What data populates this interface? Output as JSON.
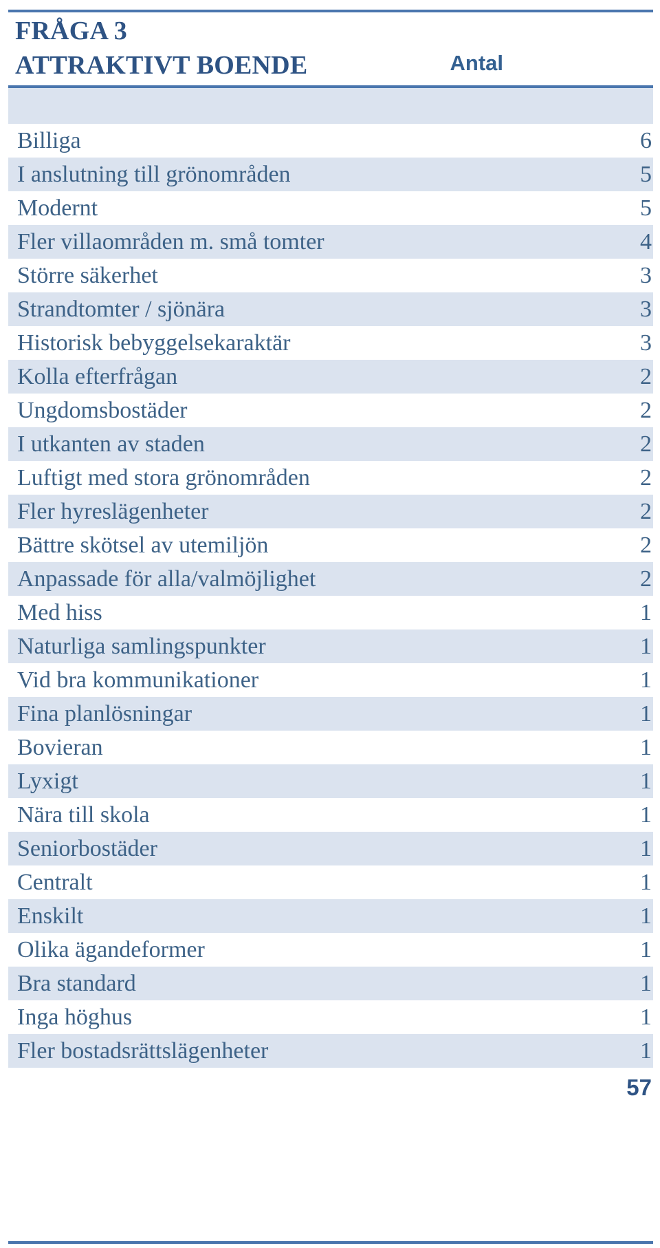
{
  "header": {
    "title_line1": "FRÅGA 3",
    "title_line2": "ATTRAKTIVT BOENDE",
    "count_column_label": "Antal"
  },
  "colors": {
    "rule": "#4a76ae",
    "heading_text": "#2e5384",
    "body_text": "#3d6287",
    "row_shaded": "#dbe3ef",
    "row_plain": "#ffffff"
  },
  "table": {
    "rows": [
      {
        "label": "Billiga",
        "value": "6"
      },
      {
        "label": "I anslutning till grönområden",
        "value": "5"
      },
      {
        "label": "Modernt",
        "value": "5"
      },
      {
        "label": "Fler villaområden m. små tomter",
        "value": "4"
      },
      {
        "label": "Större säkerhet",
        "value": "3"
      },
      {
        "label": "Strandtomter / sjönära",
        "value": "3"
      },
      {
        "label": "Historisk bebyggelsekaraktär",
        "value": "3"
      },
      {
        "label": "Kolla efterfrågan",
        "value": "2"
      },
      {
        "label": "Ungdomsbostäder",
        "value": "2"
      },
      {
        "label": "I utkanten av staden",
        "value": "2"
      },
      {
        "label": "Luftigt med stora grönområden",
        "value": "2"
      },
      {
        "label": "Fler hyreslägenheter",
        "value": "2"
      },
      {
        "label": "Bättre skötsel av utemiljön",
        "value": "2"
      },
      {
        "label": "Anpassade för alla/valmöjlighet",
        "value": "2"
      },
      {
        "label": "Med hiss",
        "value": "1"
      },
      {
        "label": "Naturliga samlingspunkter",
        "value": "1"
      },
      {
        "label": "Vid bra kommunikationer",
        "value": "1"
      },
      {
        "label": "Fina planlösningar",
        "value": "1"
      },
      {
        "label": "Bovieran",
        "value": "1"
      },
      {
        "label": "Lyxigt",
        "value": "1"
      },
      {
        "label": "Nära till skola",
        "value": "1"
      },
      {
        "label": "Seniorbostäder",
        "value": "1"
      },
      {
        "label": "Centralt",
        "value": "1"
      },
      {
        "label": "Enskilt",
        "value": "1"
      },
      {
        "label": "Olika ägandeformer",
        "value": "1"
      },
      {
        "label": "Bra standard",
        "value": "1"
      },
      {
        "label": "Inga höghus",
        "value": "1"
      },
      {
        "label": "Fler bostadsrättslägenheter",
        "value": "1"
      }
    ],
    "total": {
      "label": "",
      "value": "57"
    }
  },
  "chart_data": {
    "type": "table",
    "title": "FRÅGA 3 ATTRAKTIVT BOENDE",
    "columns": [
      "ATTRAKTIVT BOENDE",
      "Antal"
    ],
    "categories": [
      "Billiga",
      "I anslutning till grönområden",
      "Modernt",
      "Fler villaområden m. små tomter",
      "Större säkerhet",
      "Strandtomter / sjönära",
      "Historisk bebyggelsekaraktär",
      "Kolla efterfrågan",
      "Ungdomsbostäder",
      "I utkanten av staden",
      "Luftigt med stora grönområden",
      "Fler hyreslägenheter",
      "Bättre skötsel av utemiljön",
      "Anpassade för alla/valmöjlighet",
      "Med hiss",
      "Naturliga samlingspunkter",
      "Vid bra kommunikationer",
      "Fina planlösningar",
      "Bovieran",
      "Lyxigt",
      "Nära till skola",
      "Seniorbostäder",
      "Centralt",
      "Enskilt",
      "Olika ägandeformer",
      "Bra standard",
      "Inga höghus",
      "Fler bostadsrättslägenheter"
    ],
    "values": [
      6,
      5,
      5,
      4,
      3,
      3,
      3,
      2,
      2,
      2,
      2,
      2,
      2,
      2,
      1,
      1,
      1,
      1,
      1,
      1,
      1,
      1,
      1,
      1,
      1,
      1,
      1,
      1
    ],
    "total": 57,
    "xlabel": "",
    "ylabel": "Antal"
  }
}
